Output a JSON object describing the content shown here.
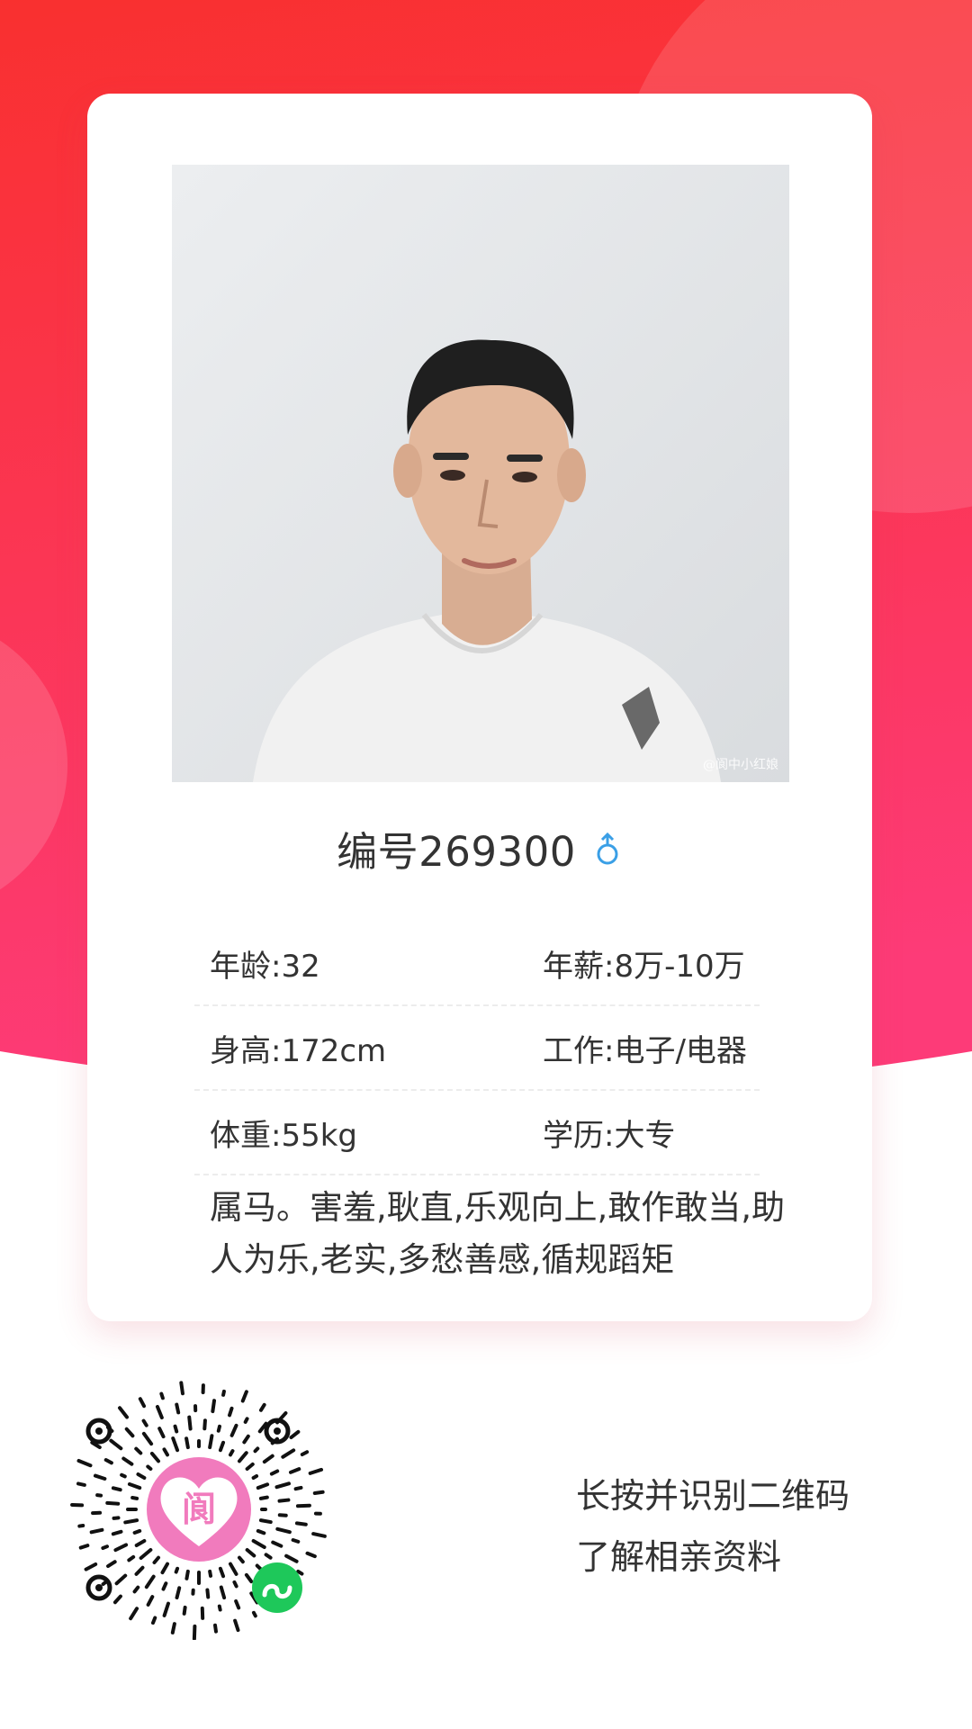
{
  "colors": {
    "gradient_top": "#f9302f",
    "gradient_bottom": "#fd3b78",
    "card_background": "#ffffff",
    "text": "#333333",
    "male_icon": "#3a9fe6",
    "qr_badge": "#f17bbd",
    "mini_program_badge": "#1ec85a"
  },
  "profile": {
    "photo": {
      "description": "portrait-photo",
      "watermark": "@阆中小红娘"
    },
    "title": "编号269300",
    "gender_icon": "male-icon",
    "info": [
      {
        "left": "年龄:32",
        "right": "年薪:8万-10万"
      },
      {
        "left": "身高:172cm",
        "right": "工作:电子/电器"
      },
      {
        "left": "体重:55kg",
        "right": "学历:大专"
      }
    ],
    "description_lines": [
      "属马。害羞,耿直,乐观向上,敢作敢当,助",
      "人为乐,老实,多愁善感,循规蹈矩"
    ]
  },
  "qr": {
    "icon": "mini-program-code-icon",
    "badge_char": "阆",
    "instructions": [
      "长按并识别二维码",
      "了解相亲资料"
    ]
  }
}
